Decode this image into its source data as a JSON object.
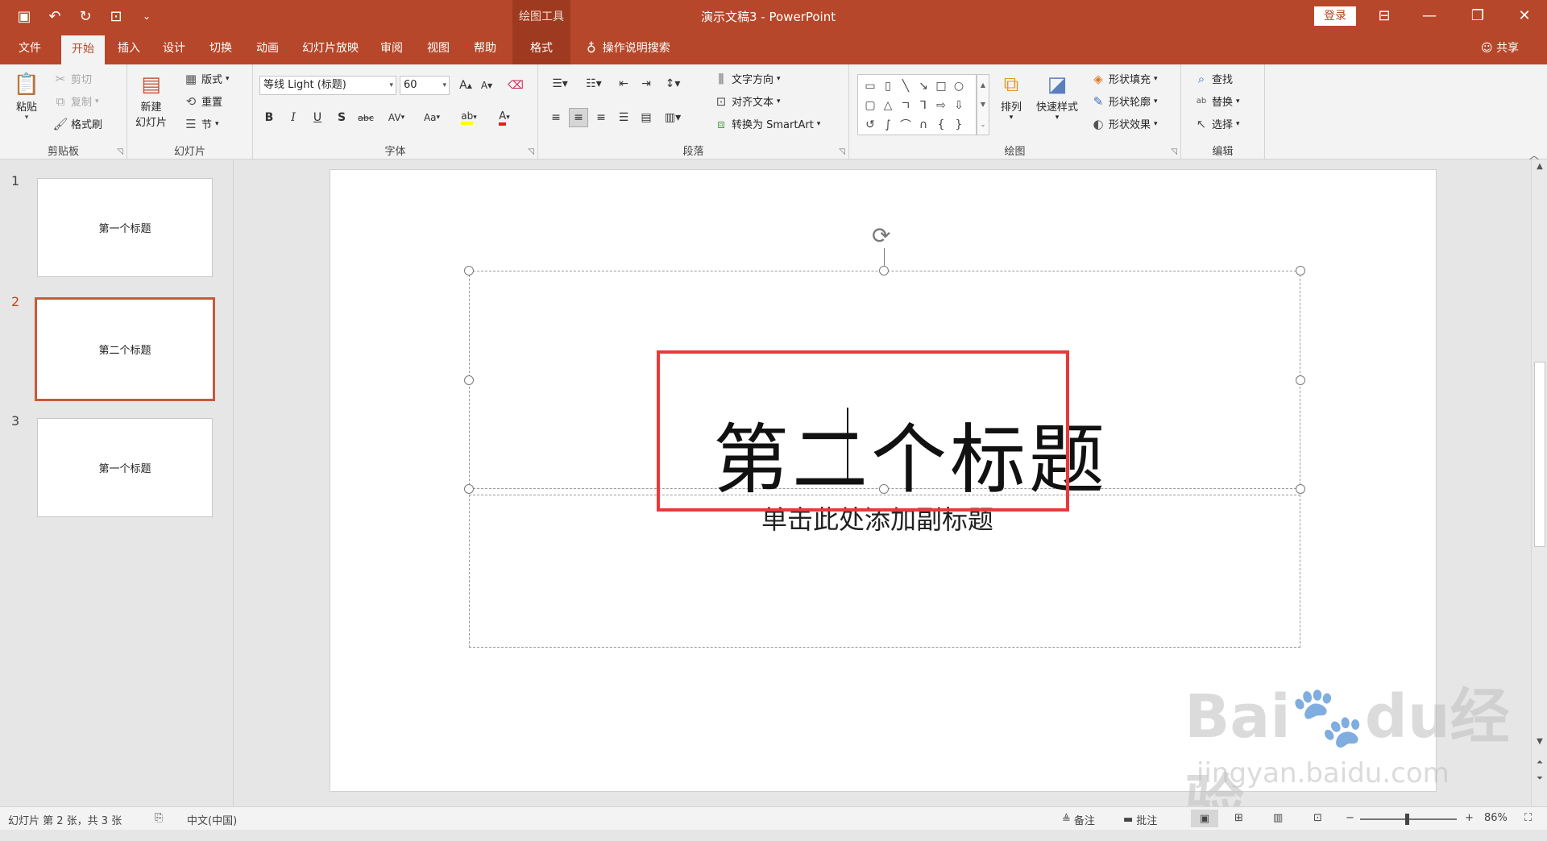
{
  "app": {
    "title": "演示文稿3 - PowerPoint",
    "context_tool": "绘图工具",
    "login": "登录",
    "share": "共享",
    "tell_me": "操作说明搜索"
  },
  "tabs": [
    "文件",
    "开始",
    "插入",
    "设计",
    "切换",
    "动画",
    "幻灯片放映",
    "审阅",
    "视图",
    "帮助",
    "格式"
  ],
  "ribbon": {
    "clipboard": {
      "label": "剪贴板",
      "paste": "粘贴",
      "cut": "剪切",
      "copy": "复制",
      "format_painter": "格式刷"
    },
    "slides": {
      "label": "幻灯片",
      "new_slide_1": "新建",
      "new_slide_2": "幻灯片",
      "layout": "版式",
      "reset": "重置",
      "section": "节"
    },
    "font": {
      "label": "字体",
      "font_name": "等线 Light (标题)",
      "font_size": "60",
      "bold": "B",
      "italic": "I",
      "underline": "U",
      "shadow": "S",
      "strike": "abc",
      "spacing": "AV",
      "case": "Aa",
      "grow": "A",
      "shrink": "A"
    },
    "paragraph": {
      "label": "段落",
      "text_direction": "文字方向",
      "align_text": "对齐文本",
      "smartart": "转换为 SmartArt"
    },
    "drawing": {
      "label": "绘图",
      "arrange": "排列",
      "quick_styles": "快速样式",
      "shape_fill": "形状填充",
      "shape_outline": "形状轮廓",
      "shape_effects": "形状效果"
    },
    "editing": {
      "label": "编辑",
      "find": "查找",
      "replace": "替换",
      "select": "选择"
    }
  },
  "slides": [
    {
      "num": "1",
      "title": "第一个标题"
    },
    {
      "num": "2",
      "title": "第二个标题"
    },
    {
      "num": "3",
      "title": "第一个标题"
    }
  ],
  "current_slide": {
    "title": "第二个标题",
    "subtitle_placeholder": "单击此处添加副标题"
  },
  "watermark": {
    "brand": "Bai",
    "brand2": "du",
    "brand3": "经验",
    "url": "jingyan.baidu.com"
  },
  "status": {
    "slide_info": "幻灯片 第 2 张，共 3 张",
    "language": "中文(中国)",
    "notes": "备注",
    "comments": "批注",
    "zoom": "86%"
  },
  "colors": {
    "accent": "#b7472a",
    "highlight": "#e9393b"
  }
}
